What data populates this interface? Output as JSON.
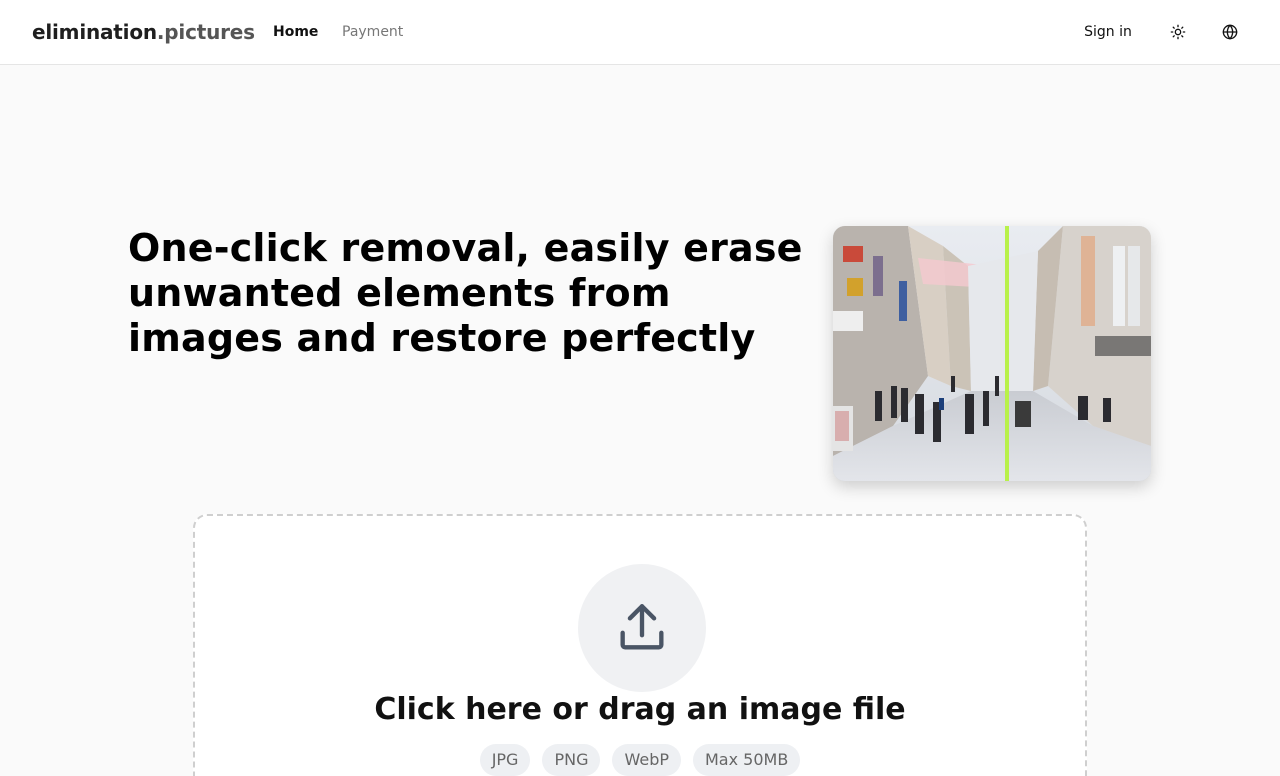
{
  "header": {
    "brand_main": "elimination",
    "brand_suffix": ".pictures",
    "nav": {
      "home": "Home",
      "payment": "Payment"
    },
    "sign_in": "Sign in",
    "icons": {
      "theme": "sun-icon",
      "language": "globe-icon"
    }
  },
  "hero": {
    "title": "One-click removal, easily erase unwanted elements from images and restore perfectly"
  },
  "upload": {
    "icon": "upload-icon",
    "label": "Click here or drag an image file",
    "formats": [
      "JPG",
      "PNG",
      "WebP",
      "Max 50MB"
    ]
  },
  "colors": {
    "accent_divider": "#b8f14a",
    "background": "#fafafa"
  }
}
